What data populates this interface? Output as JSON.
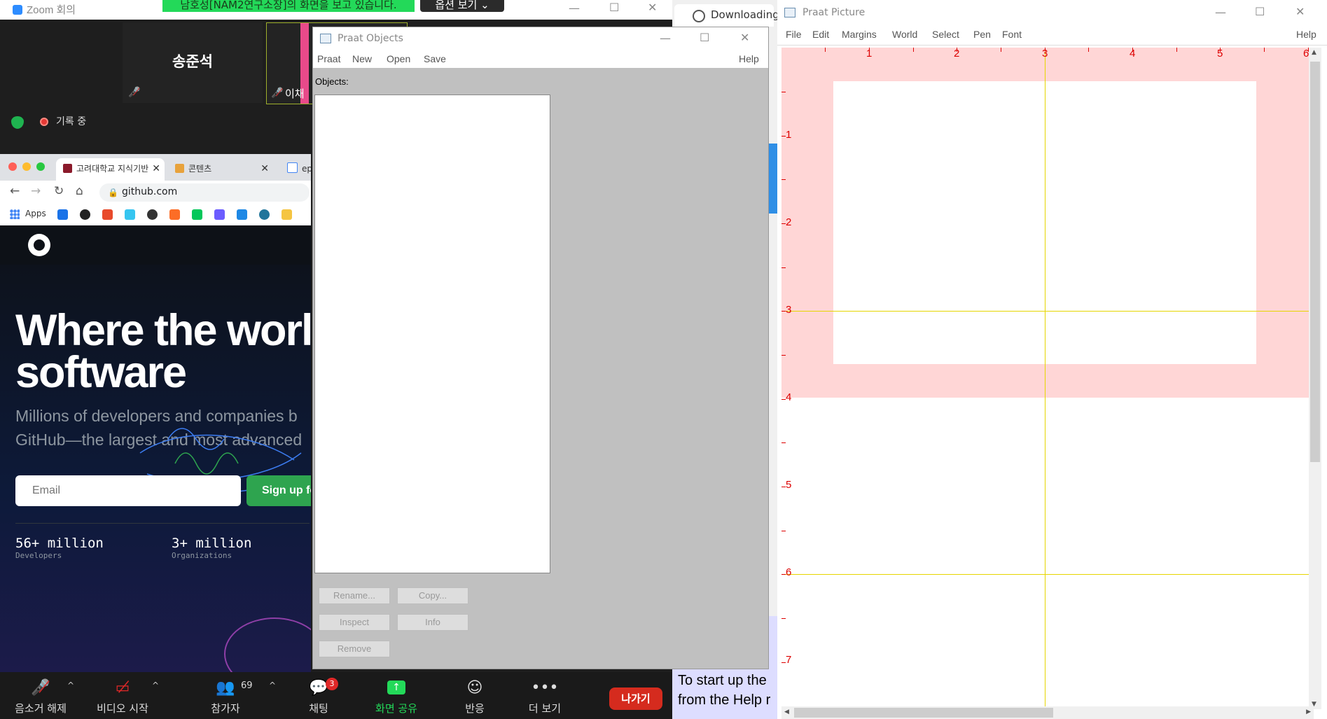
{
  "zoom": {
    "title": "Zoom 회의",
    "share_banner": "남호성[NAM2연구소장]의 화면을 보고 있습니다.",
    "view_options": "옵션 보기",
    "participant1": "송준석",
    "participant2": "이채",
    "recording": "기록 중",
    "toolbar": {
      "unmute": "음소거 해제",
      "start_video": "비디오 시작",
      "participants": "참가자",
      "participants_count": "69",
      "chat": "채팅",
      "chat_badge": "3",
      "share": "화면 공유",
      "reactions": "반응",
      "more": "더 보기",
      "leave": "나가기"
    }
  },
  "chrome": {
    "tabs": [
      {
        "label": "고려대학교 지식기반"
      },
      {
        "label": "콘텐츠"
      },
      {
        "label": "ep"
      }
    ],
    "url": "github.com",
    "bookmarks_apps": "Apps"
  },
  "github": {
    "hero_line1": "Where the worl",
    "hero_line2": "software",
    "sub_line1": "Millions of developers and companies b",
    "sub_line2": "GitHub—the largest and most advanced",
    "email_placeholder": "Email",
    "signup": "Sign up fo",
    "stats": [
      {
        "num": "56+ million",
        "label": "Developers"
      },
      {
        "num": "3+ million",
        "label": "Organizations"
      }
    ]
  },
  "praat_objects": {
    "title": "Praat Objects",
    "menus": [
      "Praat",
      "New",
      "Open",
      "Save"
    ],
    "help": "Help",
    "objects_label": "Objects:",
    "buttons": {
      "rename": "Rename...",
      "copy": "Copy...",
      "inspect": "Inspect",
      "info": "Info",
      "remove": "Remove"
    }
  },
  "middle": {
    "downloading": "Downloading",
    "help_line1": "To start up the",
    "help_line2": "from the Help r"
  },
  "praat_picture": {
    "title": "Praat Picture",
    "menus": [
      "File",
      "Edit",
      "Margins",
      "World",
      "Select",
      "Pen",
      "Font"
    ],
    "help": "Help",
    "x_ticks": [
      "1",
      "2",
      "3",
      "4",
      "5",
      "6"
    ],
    "y_ticks": [
      "1",
      "2",
      "3",
      "4",
      "5",
      "6",
      "7"
    ]
  },
  "colors": {
    "selection_pink": "#ffd6d6",
    "grid_yellow": "#e6d600",
    "ruler_red": "#dd0000",
    "github_green": "#2ea44f",
    "zoom_leave": "#d52b1e"
  }
}
